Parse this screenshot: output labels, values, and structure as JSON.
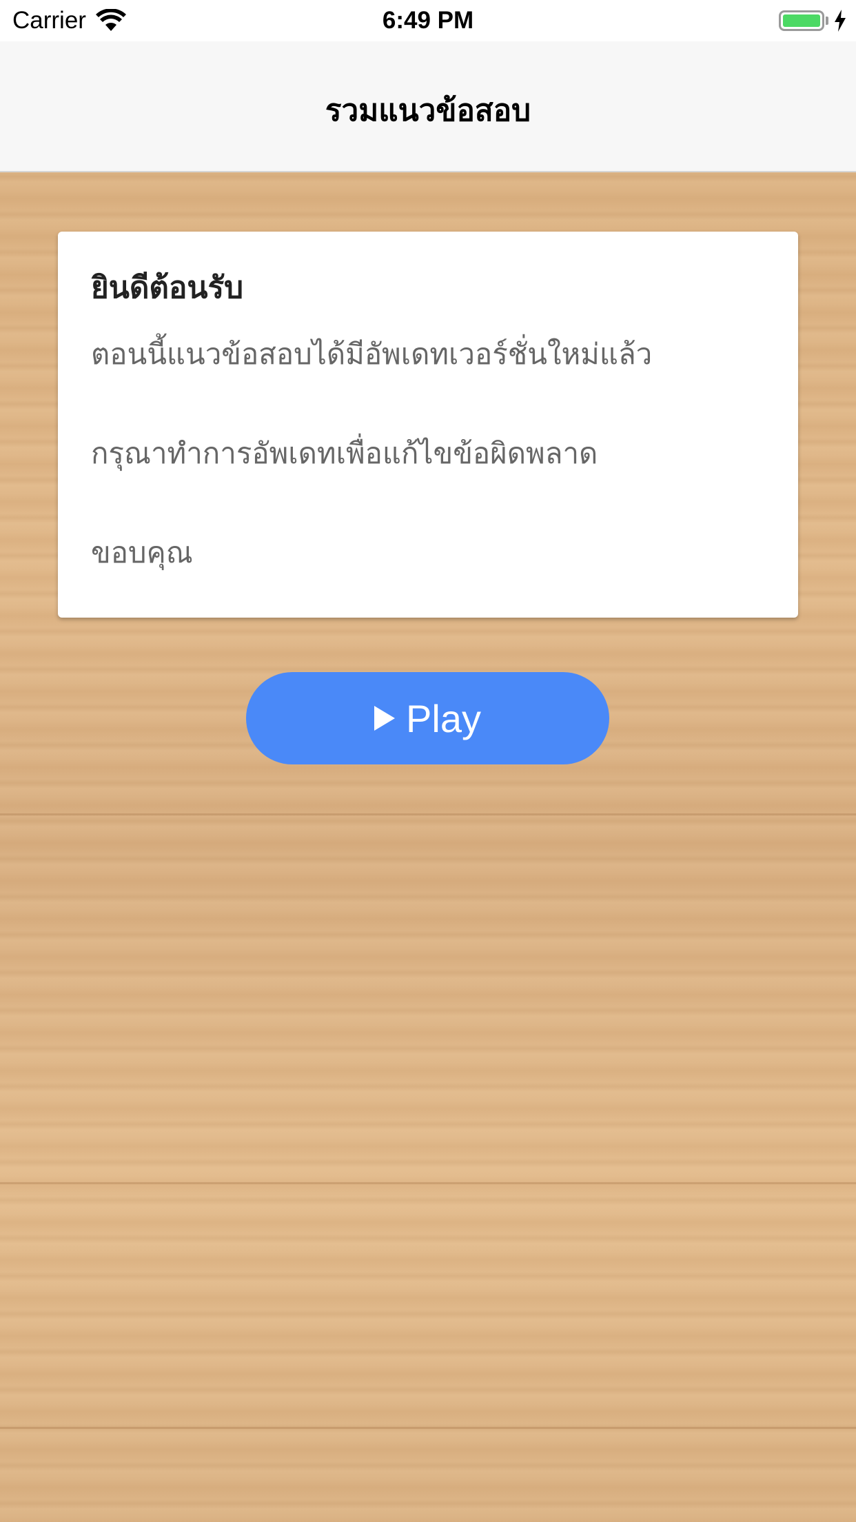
{
  "status_bar": {
    "carrier": "Carrier",
    "time": "6:49 PM",
    "battery_level": 1.0,
    "charging": true
  },
  "nav_bar": {
    "title": "รวมแนวข้อสอบ"
  },
  "card": {
    "title": "ยินดีต้อนรับ",
    "line1": "ตอนนี้แนวข้อสอบได้มีอัพเดทเวอร์ชั่นใหม่แล้ว",
    "line2": "กรุณาทำการอัพเดทเพื่อแก้ไขข้อผิดพลาด",
    "line3": "ขอบคุณ"
  },
  "play_button": {
    "label": "Play",
    "icon": "play-icon",
    "color": "#4a89f8"
  },
  "colors": {
    "nav_background": "#f7f7f7",
    "wood_background": "#e0b889",
    "battery_green": "#4cd964"
  }
}
